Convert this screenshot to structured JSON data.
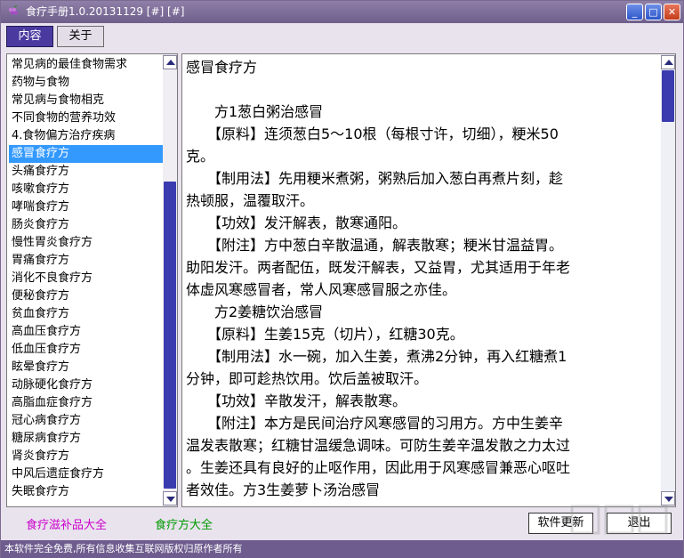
{
  "window": {
    "title": "食疗手册1.0.20131129 [#] [#]",
    "controls": {
      "minimize": "_",
      "maximize": "□",
      "close": "✕"
    }
  },
  "tabs": [
    {
      "label": "内容",
      "active": true
    },
    {
      "label": "关于",
      "active": false
    }
  ],
  "sidebar": {
    "items": [
      "常见病的最佳食物需求",
      "药物与食物",
      "常见病与食物相克",
      "不同食物的营养功效",
      "4.食物偏方治疗疾病",
      "感冒食疗方",
      "头痛食疗方",
      "咳嗽食疗方",
      "哮喘食疗方",
      "肠炎食疗方",
      "慢性胃炎食疗方",
      "胃痛食疗方",
      "消化不良食疗方",
      "便秘食疗方",
      "贫血食疗方",
      "高血压食疗方",
      "低血压食疗方",
      "眩晕食疗方",
      "动脉硬化食疗方",
      "高脂血症食疗方",
      "冠心病食疗方",
      "糖尿病食疗方",
      "肾炎食疗方",
      "中风后遗症食疗方",
      "失眠食疗方"
    ],
    "selected_index": 5
  },
  "content": {
    "lines": [
      "感冒食疗方",
      "",
      "　　方1葱白粥治感冒",
      "　　【原料】连须葱白5～10根（每根寸许，切细），粳米50",
      "克。",
      "　　【制用法】先用粳米煮粥，粥熟后加入葱白再煮片刻，趁",
      "热顿服，温覆取汗。",
      "　　【功效】发汗解表，散寒通阳。",
      "　　【附注】方中葱白辛散温通，解表散寒；粳米甘温益胃。",
      "助阳发汗。两者配伍，既发汗解表，又益胃，尤其适用于年老",
      "体虚风寒感冒者，常人风寒感冒服之亦佳。",
      "　　方2姜糖饮治感冒",
      "　　【原料】生姜15克（切片），红糖30克。",
      "　　【制用法】水一碗，加入生姜，煮沸2分钟，再入红糖煮1",
      "分钟，即可趁热饮用。饮后盖被取汗。",
      "　　【功效】辛散发汗，解表散寒。",
      "　　【附注】本方是民间治疗风寒感冒的习用方。方中生姜辛",
      "温发表散寒；红糖甘温缓急调味。可防生姜辛温发散之力太过",
      "。生姜还具有良好的止呕作用，因此用于风寒感冒兼恶心呕吐",
      "者效佳。方3生姜萝卜汤治感冒"
    ]
  },
  "bottom_links": {
    "left": "食疗滋补品大全",
    "right": "食疗方大全",
    "left_color": "#cc00cc",
    "right_color": "#009900"
  },
  "buttons": {
    "update": "软件更新",
    "exit": "退出"
  },
  "status": "本软件完全免费,所有信息收集互联网版权归原作者所有",
  "colors": {
    "selection": "#3399ff",
    "scroll_thumb": "#3b3bb0",
    "titlebar": "#7a6b97",
    "statusbar": "#6e5c8e"
  }
}
